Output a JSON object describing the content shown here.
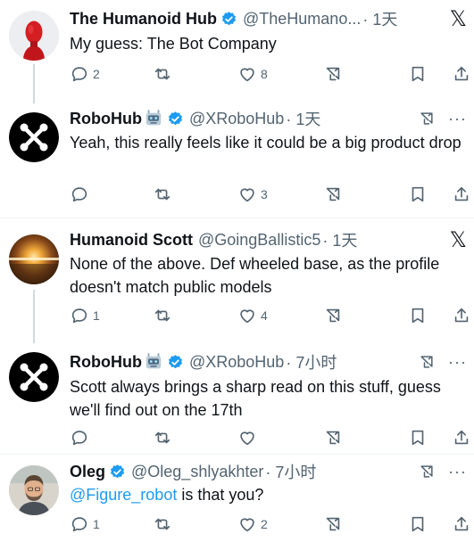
{
  "tweets": [
    {
      "name": "The Humanoid Hub",
      "handle": "@TheHumano...",
      "time": "· 1天",
      "text": "My guess: The Bot Company",
      "replies": "2",
      "retweets": "",
      "likes": "8"
    },
    {
      "name": "RoboHub",
      "handle": "@XRoboHub",
      "time": "· 1天",
      "text": "Yeah, this really feels like it could be a big product drop",
      "replies": "",
      "retweets": "",
      "likes": "3"
    },
    {
      "name": "Humanoid Scott",
      "handle": "@GoingBallistic5",
      "time": "· 1天",
      "text": "None of the above. Def wheeled base, as the profile doesn't match public models",
      "replies": "1",
      "retweets": "",
      "likes": "4"
    },
    {
      "name": "RoboHub",
      "handle": "@XRoboHub",
      "time": "· 7小时",
      "text": "Scott always brings a sharp read on this stuff, guess we'll find out on the 17th",
      "replies": "",
      "retweets": "",
      "likes": ""
    },
    {
      "name": "Oleg",
      "handle": "@Oleg_shlyakhter",
      "time": "· 7小时",
      "mention": "@Figure_robot",
      "text": " is that you?",
      "replies": "1",
      "retweets": "",
      "likes": "2"
    }
  ],
  "icons": {
    "more": "···",
    "x_logo": "𝕏"
  },
  "colors": {
    "verified": "#1d9bf0",
    "icon_gray": "#536471",
    "mention": "#1d9bf0",
    "thread_line": "#cfd9de"
  }
}
